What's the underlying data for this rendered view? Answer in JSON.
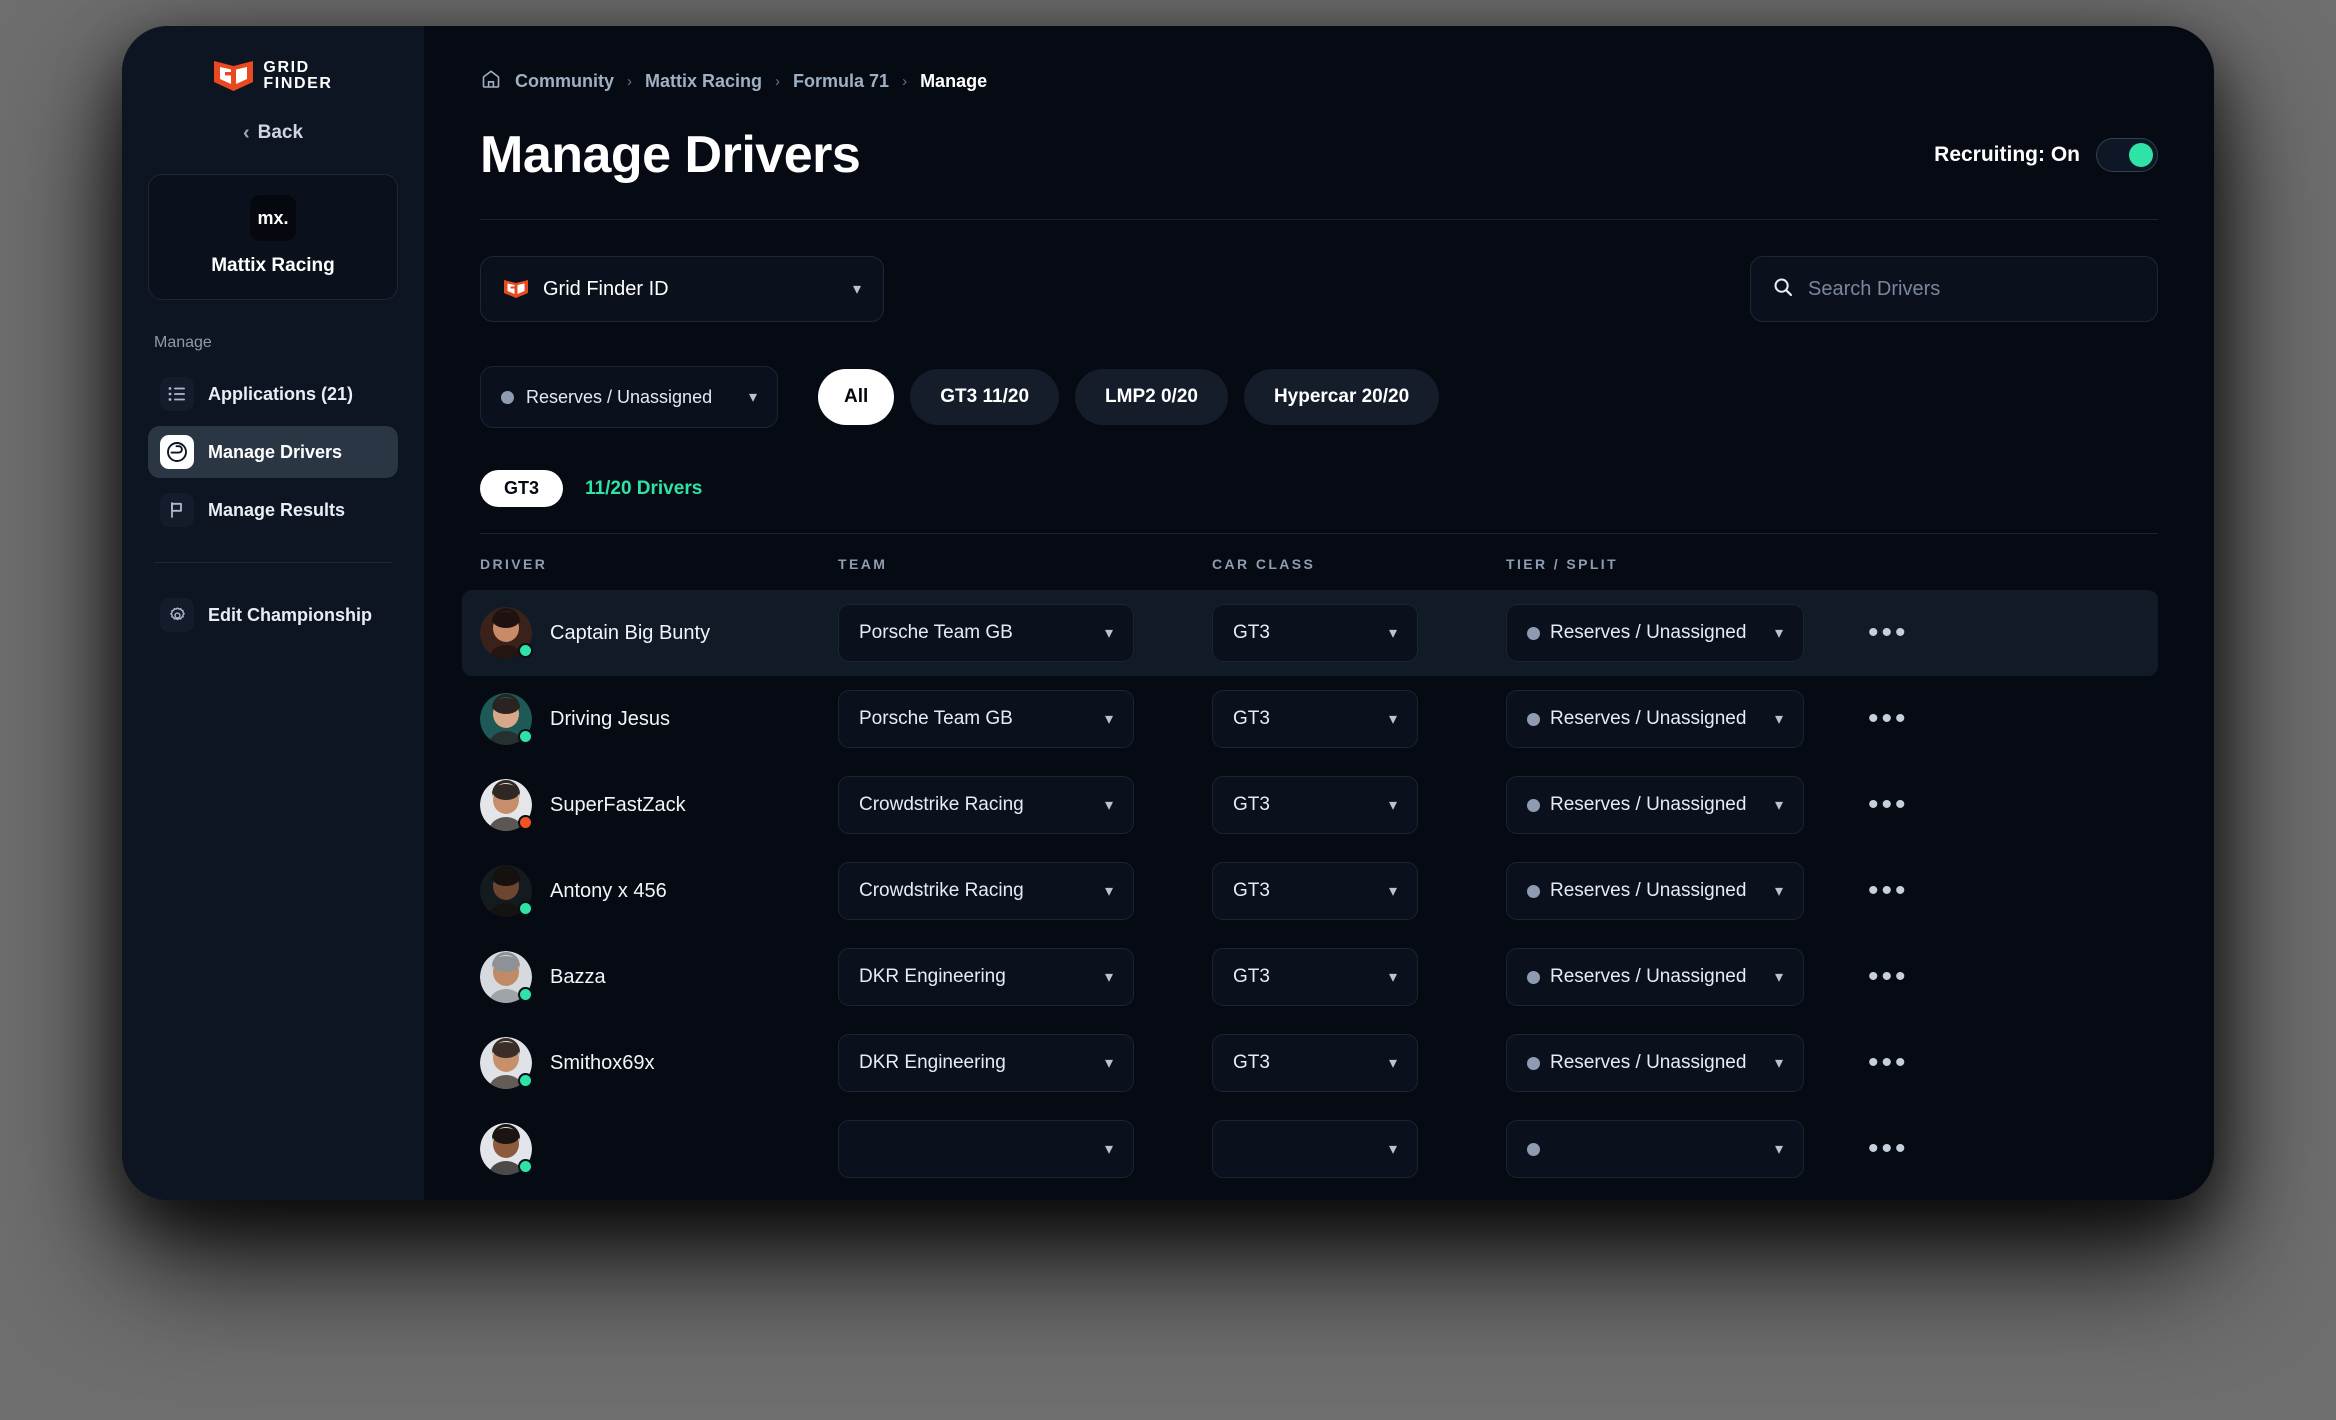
{
  "brand": {
    "logo_line1": "GRID",
    "logo_line2": "FINDER",
    "logo_mark": "GF",
    "accent_orange": "#e8491f",
    "accent_green": "#2fe3a6"
  },
  "sidebar": {
    "back_label": "Back",
    "team": {
      "avatar_initials": "mx.",
      "name": "Mattix Racing"
    },
    "section_label": "Manage",
    "items": [
      {
        "label": "Applications (21)",
        "icon": "list-icon",
        "active": false
      },
      {
        "label": "Manage Drivers",
        "icon": "helmet-icon",
        "active": true
      },
      {
        "label": "Manage Results",
        "icon": "flag-icon",
        "active": false
      }
    ],
    "footer_items": [
      {
        "label": "Edit Championship",
        "icon": "gear-icon"
      }
    ]
  },
  "breadcrumb": {
    "home_icon": "home-icon",
    "separator": "›",
    "items": [
      {
        "label": "Community",
        "current": false
      },
      {
        "label": "Mattix Racing",
        "current": false
      },
      {
        "label": "Formula 71",
        "current": false
      },
      {
        "label": "Manage",
        "current": true
      }
    ]
  },
  "header": {
    "title": "Manage Drivers",
    "recruiting_label": "Recruiting: On",
    "recruiting_on": true
  },
  "controls": {
    "id_select": {
      "label": "Grid Finder ID",
      "icon": "gridfinder-badge-icon"
    },
    "search": {
      "placeholder": "Search Drivers",
      "value": "",
      "icon": "search-icon"
    }
  },
  "filters": {
    "tier_select": {
      "label": "Reserves / Unassigned"
    },
    "pills": [
      {
        "label": "All",
        "active": true
      },
      {
        "label": "GT3 11/20",
        "active": false
      },
      {
        "label": "LMP2 0/20",
        "active": false
      },
      {
        "label": "Hypercar 20/20",
        "active": false
      }
    ]
  },
  "group": {
    "chip": "GT3",
    "count_label": "11/20 Drivers"
  },
  "table": {
    "headers": [
      "DRIVER",
      "TEAM",
      "CAR CLASS",
      "TIER / SPLIT"
    ],
    "menu_icon": "kebab-menu-icon",
    "rows": [
      {
        "driver": "Captain Big Bunty",
        "team": "Porsche Team GB",
        "car_class": "GT3",
        "tier": "Reserves / Unassigned",
        "status": "online",
        "highlight": true,
        "avatar_bg": "#3a211a",
        "skin": "#c98a68",
        "hair": "#1d1210"
      },
      {
        "driver": "Driving Jesus",
        "team": "Porsche Team GB",
        "car_class": "GT3",
        "tier": "Reserves / Unassigned",
        "status": "online",
        "highlight": false,
        "avatar_bg": "#1d5a57",
        "skin": "#d8a889",
        "hair": "#2a2320"
      },
      {
        "driver": "SuperFastZack",
        "team": "Crowdstrike Racing",
        "car_class": "GT3",
        "tier": "Reserves / Unassigned",
        "status": "offline",
        "highlight": false,
        "avatar_bg": "#e4e6e9",
        "skin": "#c88d6a",
        "hair": "#2f2722"
      },
      {
        "driver": "Antony x 456",
        "team": "Crowdstrike Racing",
        "car_class": "GT3",
        "tier": "Reserves / Unassigned",
        "status": "online",
        "highlight": false,
        "avatar_bg": "#141b1e",
        "skin": "#6d4632",
        "hair": "#16110e"
      },
      {
        "driver": "Bazza",
        "team": "DKR Engineering",
        "car_class": "GT3",
        "tier": "Reserves / Unassigned",
        "status": "online",
        "highlight": false,
        "avatar_bg": "#d6dade",
        "skin": "#c08a66",
        "hair": "#8e9196"
      },
      {
        "driver": "Smithox69x",
        "team": "DKR Engineering",
        "car_class": "GT3",
        "tier": "Reserves / Unassigned",
        "status": "online",
        "highlight": false,
        "avatar_bg": "#dfe3e7",
        "skin": "#c6906d",
        "hair": "#3a2e26"
      },
      {
        "driver": "",
        "team": "",
        "car_class": "",
        "tier": "",
        "status": "online",
        "highlight": false,
        "avatar_bg": "#e2e5e9",
        "skin": "#8c5a3c",
        "hair": "#1a1512"
      }
    ]
  },
  "status_colors": {
    "online": "#2fe3a6",
    "offline": "#f0531f"
  }
}
